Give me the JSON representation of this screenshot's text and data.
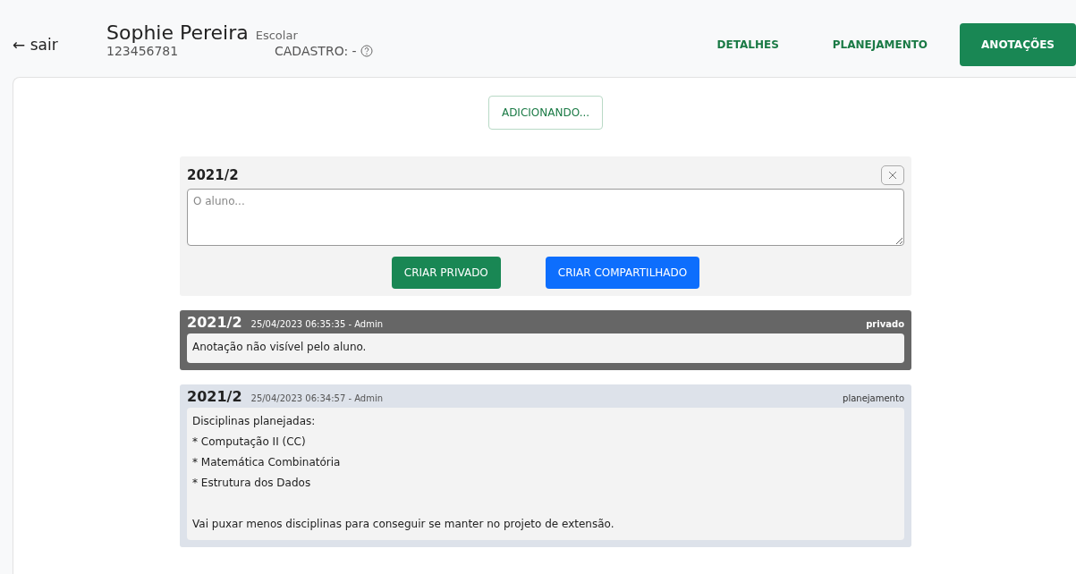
{
  "header": {
    "back_link": {
      "arrow": "←",
      "label": "sair"
    },
    "student_name": "Sophie Pereira",
    "student_type": "Escolar",
    "student_id": "123456781",
    "registration": "CADASTRO: -"
  },
  "tabs": [
    {
      "label": "DETALHES",
      "selected": false
    },
    {
      "label": "PLANEJAMENTO",
      "selected": false
    },
    {
      "label": "ANOTAÇÕES",
      "selected": true
    }
  ],
  "status_button": "ADICIONANDO...",
  "new_note": {
    "term": "2021/2",
    "placeholder": "O aluno...",
    "buttons": [
      {
        "label": "CRIAR PRIVADO",
        "kind": "private"
      },
      {
        "label": "CRIAR COMPARTILHADO",
        "kind": "shared"
      }
    ]
  },
  "notes": [
    {
      "term": "2021/2",
      "meta": "25/04/2023 06:35:35 - Admin",
      "kind": "privado",
      "tag": "privado",
      "paragraphs": [
        {
          "lines": [
            "Anotação não visível pelo aluno."
          ]
        }
      ]
    },
    {
      "term": "2021/2",
      "meta": "25/04/2023 06:34:57 - Admin",
      "kind": "planejamento",
      "tag": "planejamento",
      "paragraphs": [
        {
          "lines": [
            "Disciplinas planejadas:",
            "* Computação II (CC)",
            "* Matemática Combinatória",
            "* Estrutura dos Dados"
          ]
        },
        {
          "lines": [
            "Vai puxar menos disciplinas para conseguir se manter no projeto de extensão."
          ]
        }
      ]
    }
  ]
}
